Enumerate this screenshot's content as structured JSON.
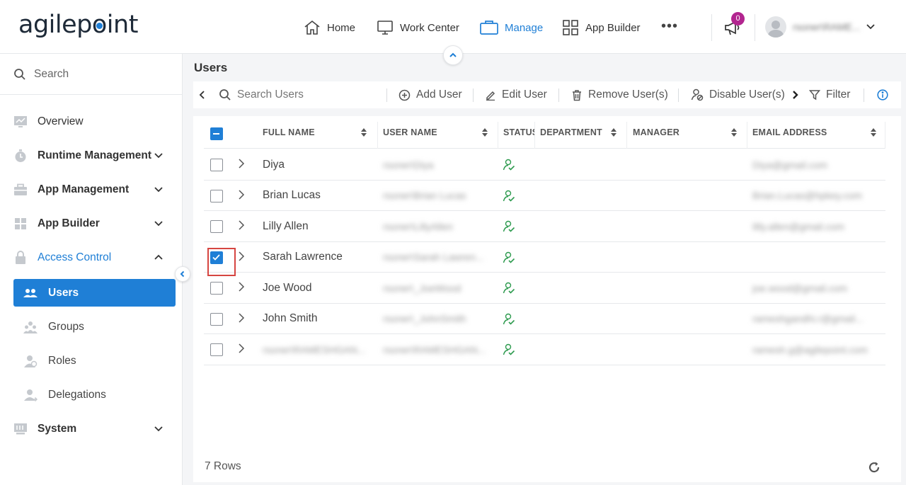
{
  "header": {
    "logo": {
      "pre": "agilep",
      "o": "o",
      "post": "int"
    },
    "nav": [
      {
        "label": "Home",
        "icon": "home-icon"
      },
      {
        "label": "Work Center",
        "icon": "monitor-icon"
      },
      {
        "label": "Manage",
        "icon": "briefcase-icon",
        "active": true
      },
      {
        "label": "App Builder",
        "icon": "grid-icon"
      }
    ],
    "more": "•••",
    "notifications": {
      "count": "0"
    },
    "user": {
      "name": "rsoner\\RAME..."
    }
  },
  "sidebar": {
    "search": {
      "placeholder": "Search"
    },
    "items": [
      {
        "label": "Overview"
      },
      {
        "label": "Runtime Management"
      },
      {
        "label": "App Management"
      },
      {
        "label": "App Builder"
      },
      {
        "label": "Access Control",
        "expanded": true
      },
      {
        "label": "System"
      }
    ],
    "access_control": [
      {
        "label": "Users",
        "active": true
      },
      {
        "label": "Groups"
      },
      {
        "label": "Roles"
      },
      {
        "label": "Delegations"
      }
    ]
  },
  "main": {
    "title": "Users",
    "toolbar": {
      "search_placeholder": "Search Users",
      "add": "Add User",
      "edit": "Edit User",
      "remove": "Remove User(s)",
      "disable": "Disable User(s)",
      "filter": "Filter"
    },
    "columns": [
      "FULL NAME",
      "USER NAME",
      "STATUS",
      "DEPARTMENT",
      "MANAGER",
      "EMAIL ADDRESS"
    ],
    "rows": [
      {
        "full_name": "Diya",
        "user_name": "rsoner\\Diya",
        "email": "Diya@gmail.com",
        "checked": false,
        "full_blur": false
      },
      {
        "full_name": "Brian Lucas",
        "user_name": "rsoner\\Brian Lucas",
        "email": "Brian.Lucas@hpkey.com",
        "checked": false,
        "full_blur": false
      },
      {
        "full_name": "Lilly Allen",
        "user_name": "rsoner\\LillyAllen",
        "email": "lilly.allen@gmail.com",
        "checked": false,
        "full_blur": false
      },
      {
        "full_name": "Sarah Lawrence",
        "user_name": "rsoner\\Sarah Lawren...",
        "email": "",
        "checked": true,
        "full_blur": false
      },
      {
        "full_name": "Joe Wood",
        "user_name": "rsoner\\_JoeWood",
        "email": "joe.wood@gmail.com",
        "checked": false,
        "full_blur": false
      },
      {
        "full_name": "John Smith",
        "user_name": "rsoner\\_JohnSmith",
        "email": "rameshgandhi.r@gmail...",
        "checked": false,
        "full_blur": false
      },
      {
        "full_name": "rsoner\\RAMESHGAN...",
        "user_name": "rsoner\\RAMESHGAN...",
        "email": "ramesh.g@agilepoint.com",
        "checked": false,
        "full_blur": true
      }
    ],
    "footer": {
      "rows_count": "7 Rows"
    }
  },
  "colors": {
    "accent": "#1f7fd6",
    "badge": "#b2258f",
    "status_active": "#2e9b4f",
    "highlight_border": "#d64541"
  }
}
